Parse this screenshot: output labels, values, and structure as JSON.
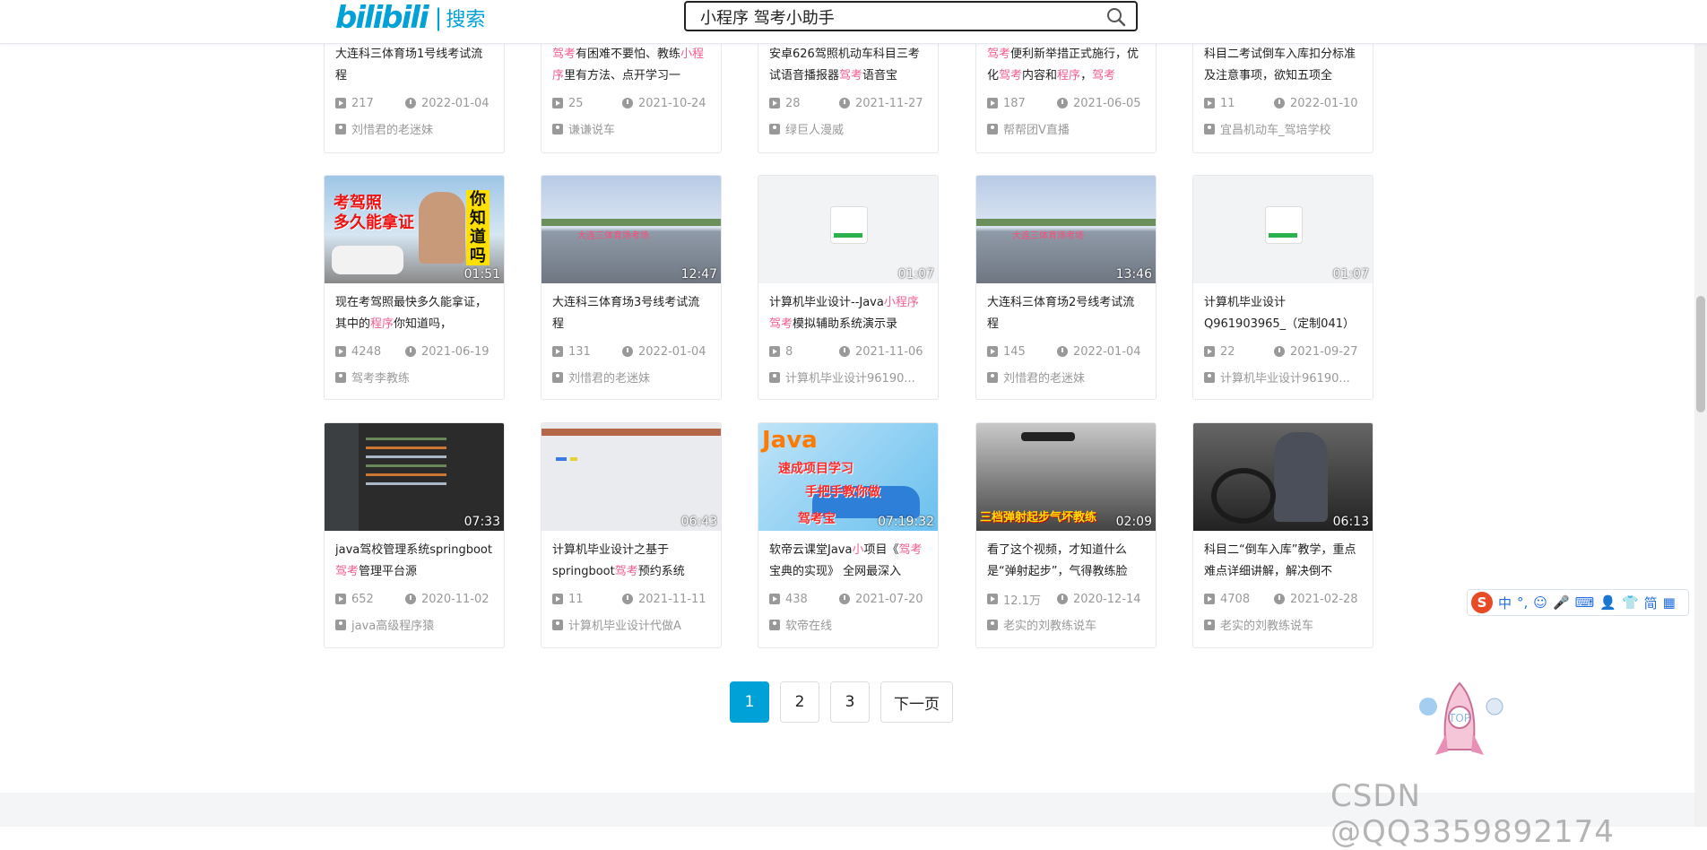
{
  "header": {
    "logo_brand": "bilibili",
    "logo_sep": "|",
    "logo_search": "搜索",
    "search_value": "小程序 驾考小助手"
  },
  "row0": [
    {
      "title_parts": [
        [
          "大连科三体育场1号线考试流程",
          ""
        ]
      ],
      "plays": "217",
      "date": "2022-01-04",
      "up": "刘惜君的老迷妹"
    },
    {
      "title_parts": [
        [
          "驾考",
          "hl"
        ],
        [
          "有困难不要怕、教练",
          ""
        ],
        [
          "小程序",
          "hl"
        ],
        [
          "里有方法、点开学习一",
          ""
        ]
      ],
      "plays": "25",
      "date": "2021-10-24",
      "up": "谦谦说车"
    },
    {
      "title_parts": [
        [
          "安卓626驾照机动车科目三考试语音播报器",
          ""
        ],
        [
          "驾考",
          "hl"
        ],
        [
          "语音宝",
          ""
        ]
      ],
      "plays": "28",
      "date": "2021-11-27",
      "up": "绿巨人漫威"
    },
    {
      "title_parts": [
        [
          "驾考",
          "hl"
        ],
        [
          "便利新举措正式施行，优化",
          ""
        ],
        [
          "驾考",
          "hl"
        ],
        [
          "内容和",
          ""
        ],
        [
          "程序",
          "hl"
        ],
        [
          "，",
          ""
        ],
        [
          "驾考",
          "hl"
        ]
      ],
      "plays": "187",
      "date": "2021-06-05",
      "up": "帮帮团V直播"
    },
    {
      "title_parts": [
        [
          "科目二考试倒车入库扣分标准及注意事项，欲知五项全",
          ""
        ]
      ],
      "plays": "11",
      "date": "2022-01-10",
      "up": "宜昌机动车_驾培学校"
    }
  ],
  "row1": [
    {
      "duration": "01:51",
      "title_parts": [
        [
          "现在考驾照最快多久能拿证，其中的",
          ""
        ],
        [
          "程序",
          "hl"
        ],
        [
          "你知道吗，",
          ""
        ]
      ],
      "plays": "4248",
      "date": "2021-06-19",
      "up": "驾考李教练",
      "thumb_text": [
        "考驾照",
        "多久能拿证",
        "你知道吗"
      ]
    },
    {
      "duration": "12:47",
      "title_parts": [
        [
          "大连科三体育场3号线考试流程",
          ""
        ]
      ],
      "plays": "131",
      "date": "2022-01-04",
      "up": "刘惜君的老迷妹"
    },
    {
      "duration": "01:07",
      "title_parts": [
        [
          "计算机毕业设计--Java",
          ""
        ],
        [
          "小程序",
          "hl"
        ],
        [
          "驾考",
          "hl"
        ],
        [
          "模拟辅助系统演示录",
          ""
        ]
      ],
      "plays": "8",
      "date": "2021-11-06",
      "up": "计算机毕业设计96190..."
    },
    {
      "duration": "13:46",
      "title_parts": [
        [
          "大连科三体育场2号线考试流程",
          ""
        ]
      ],
      "plays": "145",
      "date": "2022-01-04",
      "up": "刘惜君的老迷妹"
    },
    {
      "duration": "01:07",
      "title_parts": [
        [
          "计算机毕业设计Q961903965_（定制041）",
          ""
        ]
      ],
      "plays": "22",
      "date": "2021-09-27",
      "up": "计算机毕业设计96190..."
    }
  ],
  "row2": [
    {
      "duration": "07:33",
      "title_parts": [
        [
          "java驾校管理系统springboot",
          ""
        ],
        [
          "驾考",
          "hl"
        ],
        [
          "管理平台源",
          ""
        ]
      ],
      "plays": "652",
      "date": "2020-11-02",
      "up": "java高级程序猿"
    },
    {
      "duration": "06:43",
      "title_parts": [
        [
          "计算机毕业设计之基于springboot",
          ""
        ],
        [
          "驾考",
          "hl"
        ],
        [
          "预约系统",
          ""
        ]
      ],
      "plays": "11",
      "date": "2021-11-11",
      "up": "计算机毕业设计代做A"
    },
    {
      "duration": "07:19:32",
      "title_parts": [
        [
          "软帝云课堂Java",
          ""
        ],
        [
          "小",
          "hl"
        ],
        [
          "项目《",
          ""
        ],
        [
          "驾考",
          "hl"
        ],
        [
          "宝典的实现》 全网最深入",
          ""
        ]
      ],
      "plays": "438",
      "date": "2021-07-20",
      "up": "软帝在线",
      "thumb_text": [
        "Java",
        "速成项目学习",
        "手把手教你做",
        "驾考宝"
      ]
    },
    {
      "duration": "02:09",
      "title_parts": [
        [
          "看了这个视频，才知道什么是“弹射起步”，气得教练脸",
          ""
        ]
      ],
      "plays": "12.1万",
      "date": "2020-12-14",
      "up": "老实的刘教练说车",
      "thumb_text": [
        "三档弹射起步气坏教练"
      ]
    },
    {
      "duration": "06:13",
      "title_parts": [
        [
          "科目二“倒车入库”教学，重点难点详细讲解，解决倒不",
          ""
        ]
      ],
      "plays": "4708",
      "date": "2021-02-28",
      "up": "老实的刘教练说车"
    }
  ],
  "pagination": {
    "pages": [
      "1",
      "2",
      "3"
    ],
    "next": "下一页",
    "current": "1"
  },
  "ime": {
    "items": [
      "中",
      "°,",
      "☺",
      "🎤",
      "⌨",
      "👤",
      "👕",
      "简",
      "▦"
    ]
  },
  "rocket_label": "TOP",
  "watermark": "CSDN @QQ3359892174",
  "colors": {
    "accent": "#00a1d6",
    "highlight": "#f25d8e",
    "meta": "#999999"
  }
}
